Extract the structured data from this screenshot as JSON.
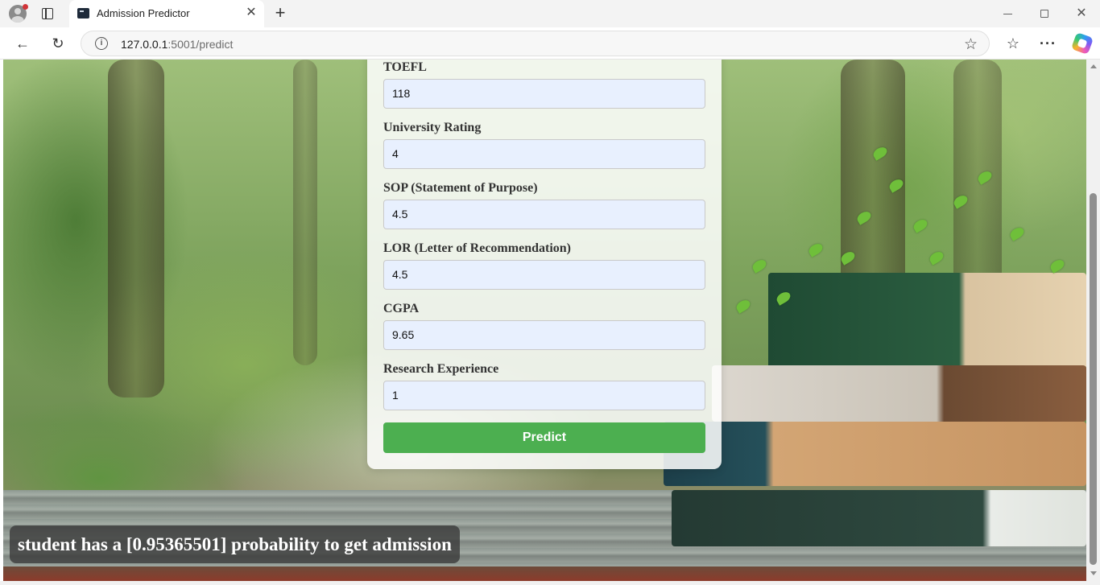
{
  "browser": {
    "tab_title": "Admission Predictor",
    "url_host": "127.0.0.1",
    "url_path": ":5001/predict",
    "icons": {
      "profile": "profile-avatar-icon",
      "tab_actions": "tab-actions-icon",
      "favicon": "terminal-favicon-icon",
      "close": "close-icon",
      "new_tab": "plus-icon",
      "back": "arrow-left-icon",
      "reload": "reload-icon",
      "site_info": "info-icon",
      "favorite": "star-icon",
      "favorites": "favorites-list-icon",
      "more": "more-icon",
      "copilot": "copilot-icon"
    },
    "glyphs": {
      "close": "✕",
      "new_tab": "+",
      "back": "←",
      "reload": "↻",
      "info": "i",
      "star": "☆",
      "favorites": "☆",
      "more": "···",
      "win_close": "✕"
    }
  },
  "form": {
    "fields": [
      {
        "label": "TOEFL",
        "value": "118"
      },
      {
        "label": "University Rating",
        "value": "4"
      },
      {
        "label": "SOP (Statement of Purpose)",
        "value": "4.5"
      },
      {
        "label": "LOR (Letter of Recommendation)",
        "value": "4.5"
      },
      {
        "label": "CGPA",
        "value": "9.65"
      },
      {
        "label": "Research Experience",
        "value": "1"
      }
    ],
    "submit_label": "Predict"
  },
  "result": {
    "text": "student has a [0.95365501] probability to get admission"
  },
  "colors": {
    "accent_button": "#4caf50",
    "input_background": "#e8f0fe",
    "result_background": "#3c3c3c"
  }
}
